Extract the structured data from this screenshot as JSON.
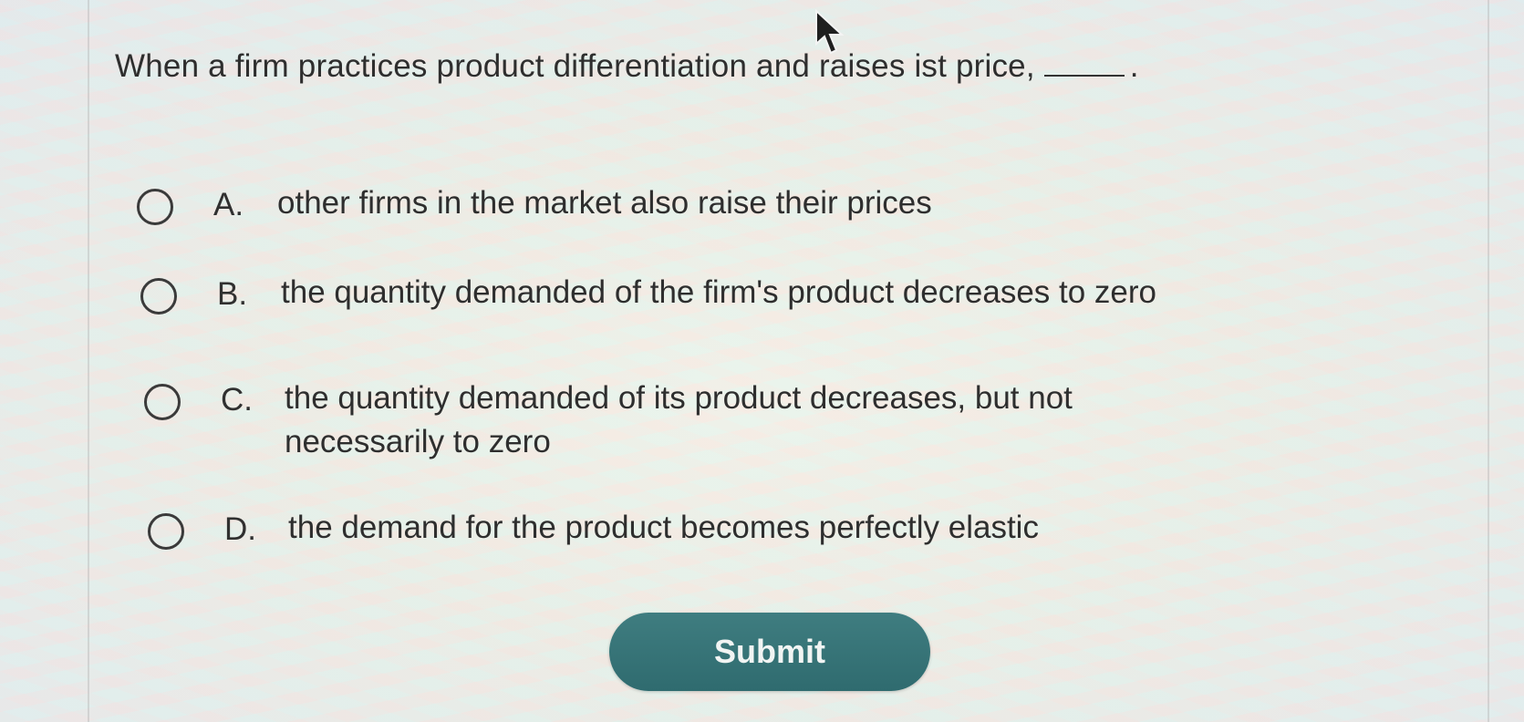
{
  "question": {
    "text": "When a firm practices product differentiation and raises ist price,",
    "trailing": "."
  },
  "choices": [
    {
      "letter": "A.",
      "text": "other firms in the market also raise their prices"
    },
    {
      "letter": "B.",
      "text": "the quantity demanded of the firm's product decreases to zero"
    },
    {
      "letter": "C.",
      "text": "the quantity demanded of its product decreases, but not necessarily to zero"
    },
    {
      "letter": "D.",
      "text": "the demand for the product becomes perfectly elastic"
    }
  ],
  "submit_label": "Submit",
  "colors": {
    "submit_bg": "#3a7679",
    "submit_text": "#f1f4f3",
    "text": "#2e2e2e"
  },
  "icons": {
    "cursor": "mouse-pointer-icon",
    "radio": "radio-button-empty"
  }
}
